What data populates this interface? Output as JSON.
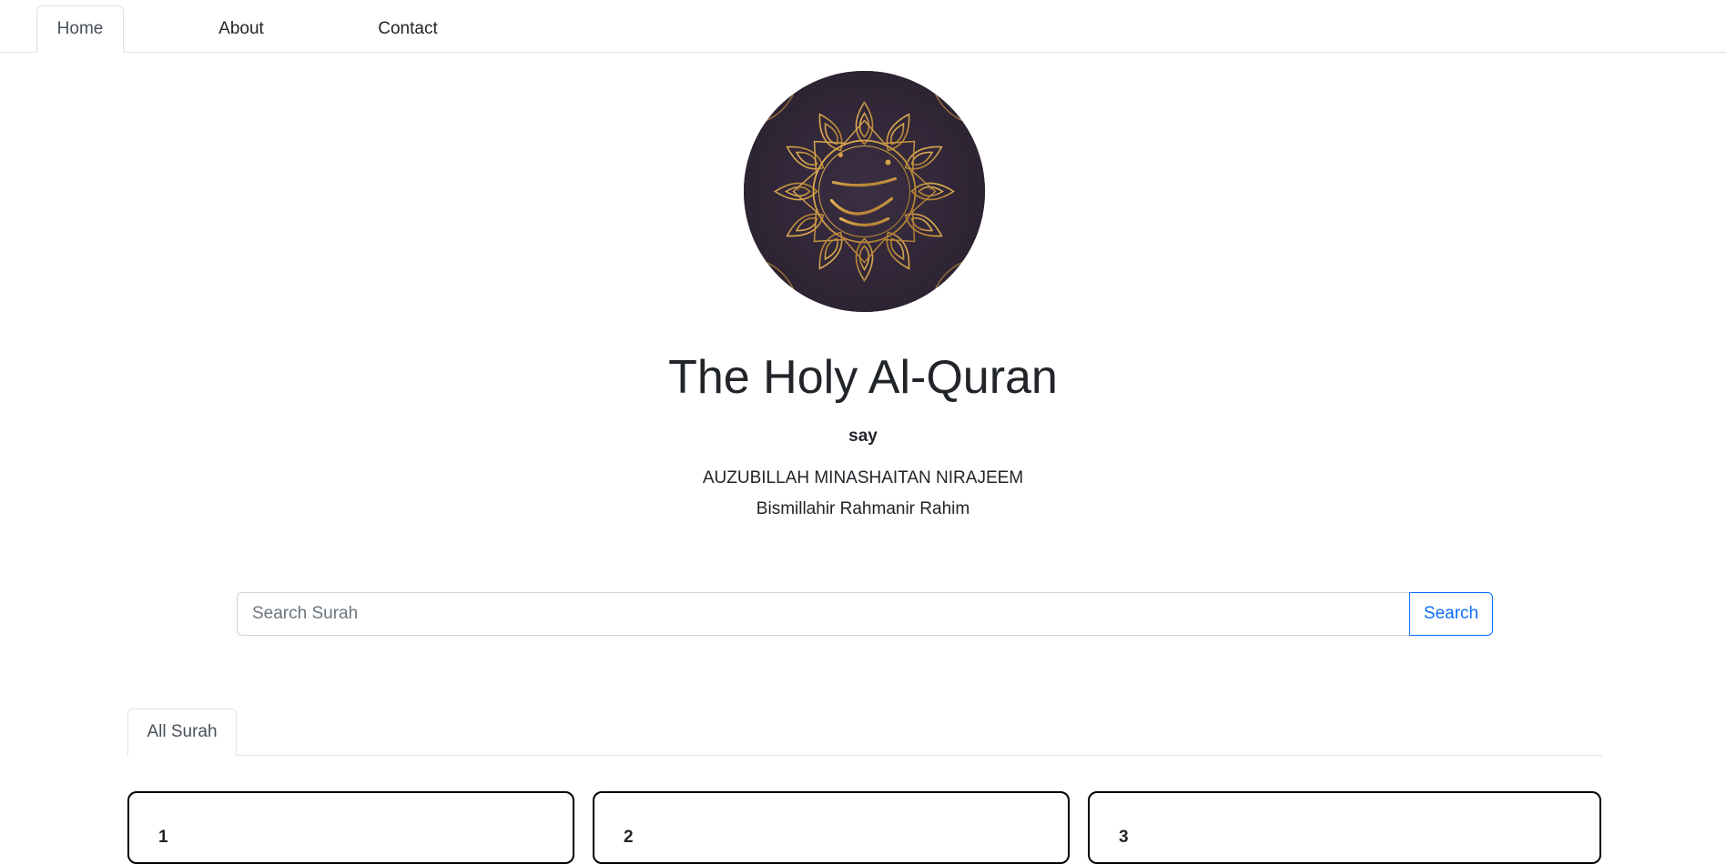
{
  "nav": {
    "items": [
      {
        "label": "Home",
        "active": true
      },
      {
        "label": "About",
        "active": false
      },
      {
        "label": "Contact",
        "active": false
      }
    ]
  },
  "hero": {
    "logo_icon": "quran-calligraphy-logo",
    "title": "The Holy Al-Quran",
    "say": "say",
    "line1": "AUZUBILLAH MINASHAITAN NIRAJEEM",
    "line2": "Bismillahir Rahmanir Rahim"
  },
  "search": {
    "placeholder": "Search Surah",
    "value": "",
    "button_label": "Search"
  },
  "tabs": [
    {
      "label": "All Surah",
      "active": true
    }
  ],
  "surahs": [
    {
      "number": "1"
    },
    {
      "number": "2"
    },
    {
      "number": "3"
    }
  ],
  "colors": {
    "accent": "#0d6efd",
    "logo_bg": "#2f2535",
    "logo_gold": "#c9953f"
  }
}
